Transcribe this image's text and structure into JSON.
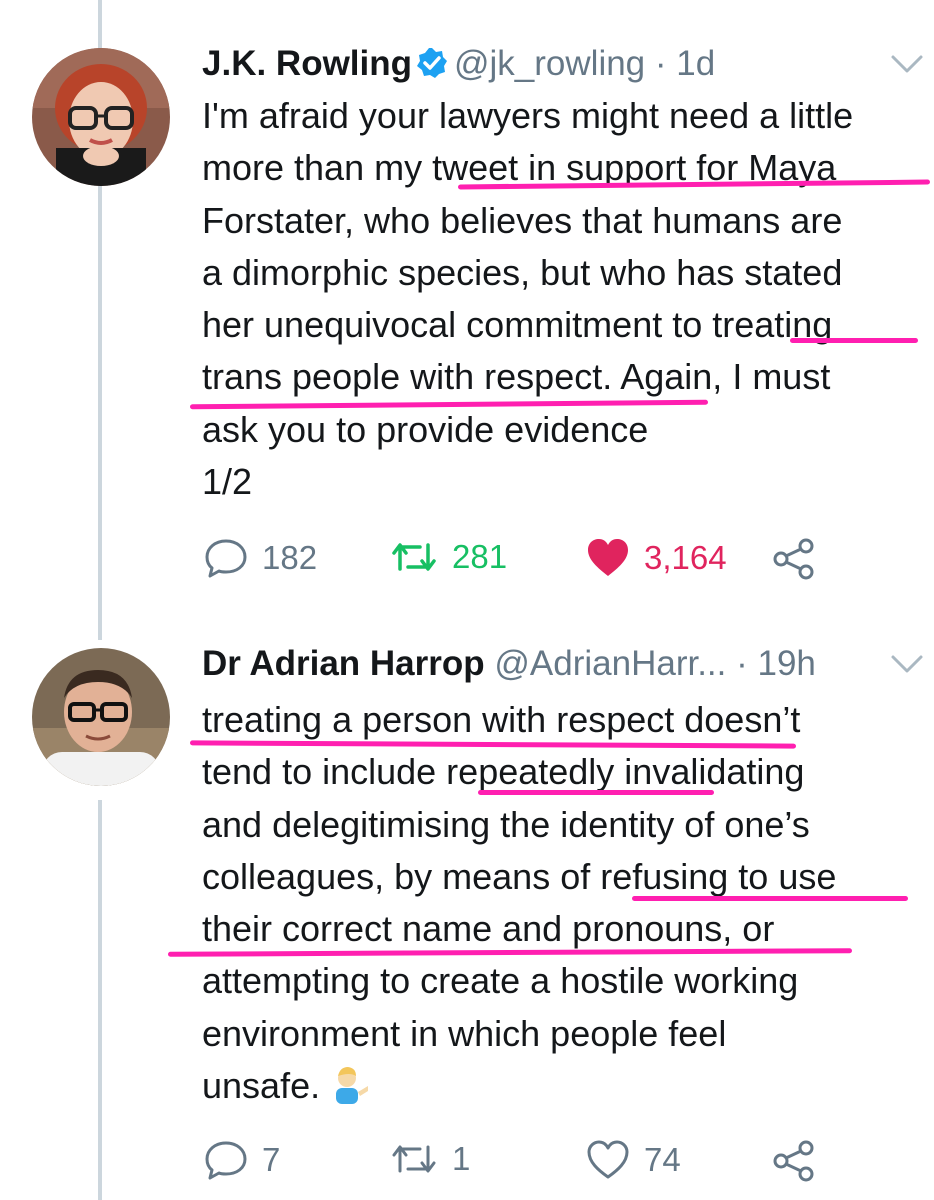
{
  "tweets": [
    {
      "name": "J.K. Rowling",
      "handle": "@jk_rowling",
      "dot": "·",
      "time": "1d",
      "verified": true,
      "lines": [
        "I'm afraid your lawyers might need a little",
        "more than my tweet in support for Maya",
        "Forstater, who believes that humans are",
        "a dimorphic species, but who has stated",
        "her unequivocal commitment to treating",
        "trans people with respect. Again, I must",
        "ask you to provide evidence",
        "1/2"
      ],
      "actions": {
        "replies": "182",
        "retweets": "281",
        "likes": "3,164",
        "liked": true,
        "retweeted": true
      }
    },
    {
      "name": "Dr Adrian Harrop",
      "handle": "@AdrianHarr...",
      "dot": "·",
      "time": "19h",
      "verified": false,
      "lines": [
        "treating a person with respect doesn’t",
        "tend to include repeatedly invalidating",
        "and delegitimising the identity of one’s",
        "colleagues, by means of refusing to use",
        "their correct name and pronouns, or",
        "attempting to create a hostile working",
        "environment in which people feel",
        "unsafe."
      ],
      "emoji": "person-tipping-hand-emoji",
      "actions": {
        "replies": "7",
        "retweets": "1",
        "likes": "74",
        "liked": false,
        "retweeted": false
      }
    }
  ],
  "colors": {
    "highlight": "#ff1fb0",
    "verified": "#1da1f2",
    "retweet_active": "#17bf63",
    "like_active": "#e0245e",
    "muted": "#657786",
    "thread_line": "#ccd6dd"
  },
  "icons": [
    "verified-badge-icon",
    "chevron-down-icon",
    "reply-icon",
    "retweet-icon",
    "heart-icon",
    "share-icon"
  ]
}
